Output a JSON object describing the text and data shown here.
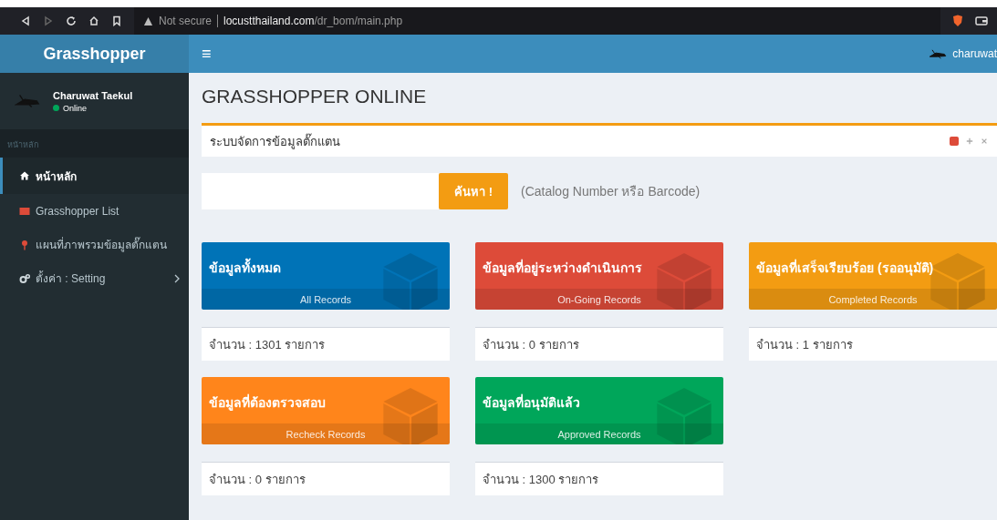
{
  "browser": {
    "security": "Not secure",
    "url_host": "locustthailand.com",
    "url_path": "/dr_bom/main.php"
  },
  "header": {
    "brand": "Grasshopper",
    "menu_glyph": "≡",
    "user": "charuwat"
  },
  "sidebar": {
    "user": {
      "name": "Charuwat Taekul",
      "status": "Online"
    },
    "section": "หน้าหลัก",
    "items": [
      {
        "label": "หน้าหลัก",
        "kind": "home",
        "selected": true,
        "submenu": false
      },
      {
        "label": "Grasshopper List",
        "kind": "list",
        "selected": false,
        "submenu": false
      },
      {
        "label": "แผนที่ภาพรวมข้อมูลตั๊กแตน",
        "kind": "map",
        "selected": false,
        "submenu": false
      },
      {
        "label": "ตั้งค่า : Setting",
        "kind": "settings",
        "selected": false,
        "submenu": true
      }
    ]
  },
  "content": {
    "title": "GRASSHOPPER ONLINE",
    "box_title": "ระบบจัดการข้อมูลตั๊กแตน",
    "search": {
      "button": "ค้นหา !",
      "hint": "(Catalog Number หรือ Barcode)"
    },
    "cards": [
      {
        "title": "ข้อมูลทั้งหมด",
        "subtitle": "All Records",
        "color": "#0073b7",
        "count": "จำนวน : 1301 รายการ"
      },
      {
        "title": "ข้อมูลที่อยู่ระหว่างดำเนินการ",
        "subtitle": "On-Going Records",
        "color": "#dd4b39",
        "count": "จำนวน : 0 รายการ"
      },
      {
        "title": "ข้อมูลที่เสร็จเรียบร้อย (รออนุมัติ)",
        "subtitle": "Completed Records",
        "color": "#f39c12",
        "count": "จำนวน : 1 รายการ"
      },
      {
        "title": "ข้อมูลที่ต้องตรวจสอบ",
        "subtitle": "Recheck Records",
        "color": "#ff851b",
        "count": "จำนวน : 0 รายการ"
      },
      {
        "title": "ข้อมูลที่อนุมัติแล้ว",
        "subtitle": "Approved Records",
        "color": "#00a65a",
        "count": "จำนวน : 1300 รายการ"
      }
    ]
  }
}
